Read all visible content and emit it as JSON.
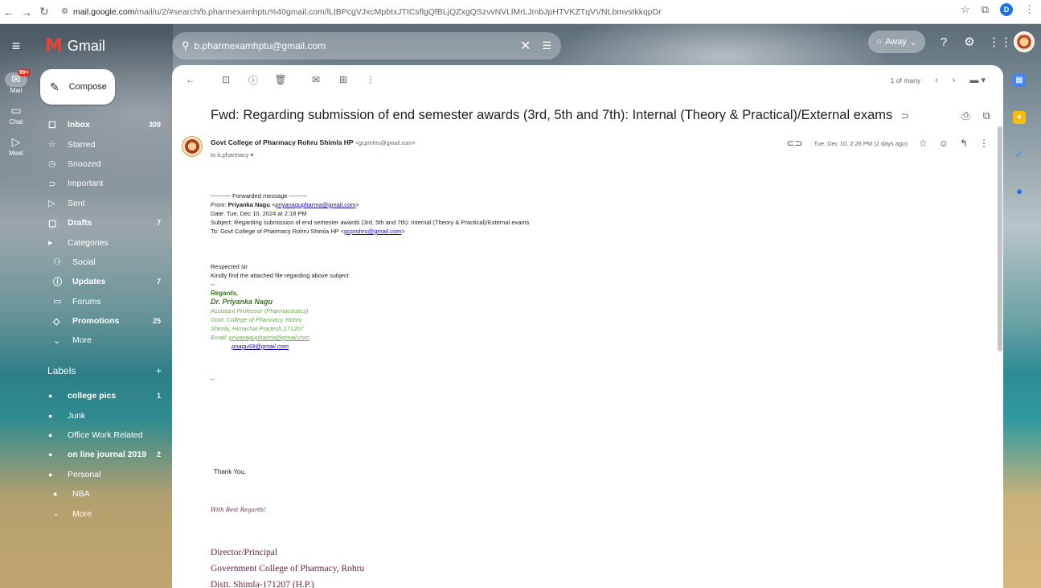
{
  "browser": {
    "url_host": "mail.google.com",
    "url_path": "/mail/u/2/#search/b.pharmexamhptu%40gmail.com/lLtBPcgVJxcMpbtxJTtCsflgQfBLjQZxgQSzvvNVLlMrLJmbJpHTVKZTqVVNLbmvstkkqpDr",
    "profile_initial": "D"
  },
  "header": {
    "app_name": "Gmail",
    "search_value": "b.pharmexamhptu@gmail.com",
    "status": "Away"
  },
  "rail": {
    "mail_label": "Mail",
    "mail_badge": "99+",
    "chat_label": "Chat",
    "meet_label": "Meet"
  },
  "sidebar": {
    "compose": "Compose",
    "items": [
      {
        "label": "Inbox",
        "count": "309",
        "icon": "inbox-icon",
        "glyph": "☐"
      },
      {
        "label": "Starred",
        "count": "",
        "icon": "star-icon",
        "glyph": "☆"
      },
      {
        "label": "Snoozed",
        "count": "",
        "icon": "clock-icon",
        "glyph": "◷"
      },
      {
        "label": "Important",
        "count": "",
        "icon": "important-icon",
        "glyph": "⊃"
      },
      {
        "label": "Sent",
        "count": "",
        "icon": "send-icon",
        "glyph": "▷"
      },
      {
        "label": "Drafts",
        "count": "7",
        "icon": "draft-icon",
        "glyph": "▢"
      },
      {
        "label": "Categories",
        "count": "",
        "icon": "label-icon",
        "glyph": "▸"
      },
      {
        "label": "Social",
        "count": "",
        "icon": "people-icon",
        "glyph": "⚇"
      },
      {
        "label": "Updates",
        "count": "7",
        "icon": "info-icon",
        "glyph": "ⓘ"
      },
      {
        "label": "Forums",
        "count": "",
        "icon": "forum-icon",
        "glyph": "▭"
      },
      {
        "label": "Promotions",
        "count": "25",
        "icon": "tag-icon",
        "glyph": "◇"
      },
      {
        "label": "More",
        "count": "",
        "icon": "chevron-down-icon",
        "glyph": "⌄"
      }
    ],
    "labels_title": "Labels",
    "labels": [
      {
        "label": "college pics",
        "count": "1"
      },
      {
        "label": "Junk",
        "count": ""
      },
      {
        "label": "Office Work Related",
        "count": ""
      },
      {
        "label": "on line journal 2019",
        "count": "2"
      },
      {
        "label": "Personal",
        "count": ""
      },
      {
        "label": "NBA",
        "count": ""
      },
      {
        "label": "More",
        "count": ""
      }
    ]
  },
  "toolbar": {
    "pager": "1 of many"
  },
  "email": {
    "subject": "Fwd: Regarding submission of end semester awards (3rd, 5th and 7th): Internal (Theory & Practical)/External exams",
    "sender_name": "Govt College of Pharmacy Rohru Shimla HP",
    "sender_email": "<gcprohru@gmail.com>",
    "to": "to b.pharmacy",
    "date": "Tue, Dec 10, 2:26 PM (2 days ago)",
    "fwd_header": "---------- Forwarded message ---------",
    "from_label": "From: ",
    "from_name": "Priyanka Nagu",
    "from_email": "priyanagupharma@gmail.com",
    "date_line": "Date: Tue, Dec 10, 2024 at 2:18 PM",
    "subject_line": "Subject: Regarding submission of end semester awards (3rd, 5th and 7th): Internal (Theory & Practical)/External exams",
    "to_line": "To: Govt College of Pharmacy Rohru Shimla HP <",
    "to_email": "gcprohru@gmail.com",
    "greeting": "Respected sir",
    "message": "Kindly find the attached file regarding above subject",
    "dash": "--",
    "regards": "Regards,",
    "sig_name": "Dr. Priyanka Nagu",
    "sig_title": "Assistant Professor (Pharmaceutics)",
    "sig_college": "Govt. College of Pharmacy, Rohru",
    "sig_address": "Shimla, Himachal Pradesh,171207",
    "sig_email_label": "Email: ",
    "sig_email1": "priyanagupharma@gmail.com",
    "sig_email2": "pnagu69@gmail.com",
    "dash2": "--",
    "thanks": "Thank You,",
    "best_regards": "With Best Regards!",
    "director_lines": [
      "Director/Principal",
      "Government College of Pharmacy, Rohru",
      "Distt. Shimla-171207 (H.P.)"
    ]
  }
}
